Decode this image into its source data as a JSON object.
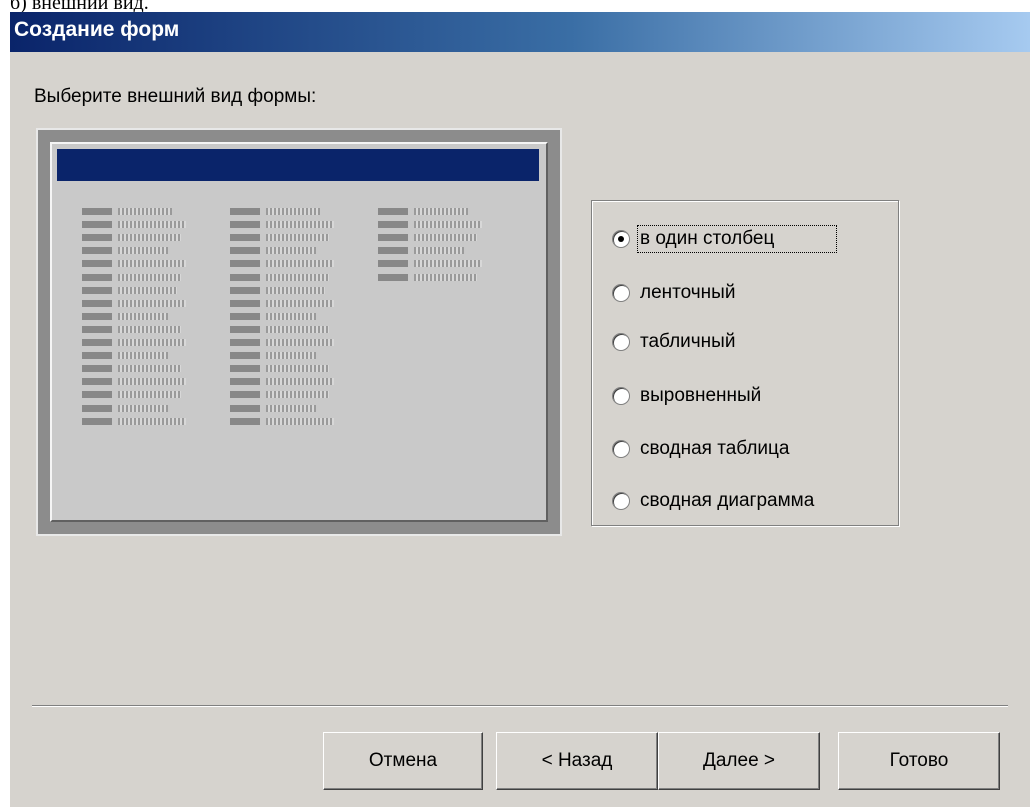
{
  "caption": "б) внешний вид.",
  "window": {
    "title": "Создание форм"
  },
  "prompt": "Выберите внешний вид формы:",
  "preview": {
    "col1_fields": [
      0.6,
      0.75,
      0.7,
      0.55,
      0.75,
      0.7,
      0.65,
      0.75,
      0.55,
      0.7,
      0.75,
      0.55,
      0.7,
      0.75,
      0.7,
      0.55,
      0.75
    ],
    "col2_fields": [
      0.6,
      0.75,
      0.7,
      0.55,
      0.75,
      0.7,
      0.65,
      0.75,
      0.55,
      0.7,
      0.75,
      0.55,
      0.7,
      0.75,
      0.7,
      0.55,
      0.75
    ],
    "col3_fields": [
      0.6,
      0.75,
      0.7,
      0.55,
      0.75,
      0.7
    ]
  },
  "layout_options": [
    {
      "label": "в один столбец",
      "checked": true
    },
    {
      "label": "ленточный",
      "checked": false
    },
    {
      "label": "табличный",
      "checked": false
    },
    {
      "label": "выровненный",
      "checked": false
    },
    {
      "label": "сводная таблица",
      "checked": false
    },
    {
      "label": "сводная диаграмма",
      "checked": false
    }
  ],
  "buttons": {
    "cancel": "Отмена",
    "back": "< Назад",
    "next": "Далее >",
    "finish": "Готово"
  }
}
